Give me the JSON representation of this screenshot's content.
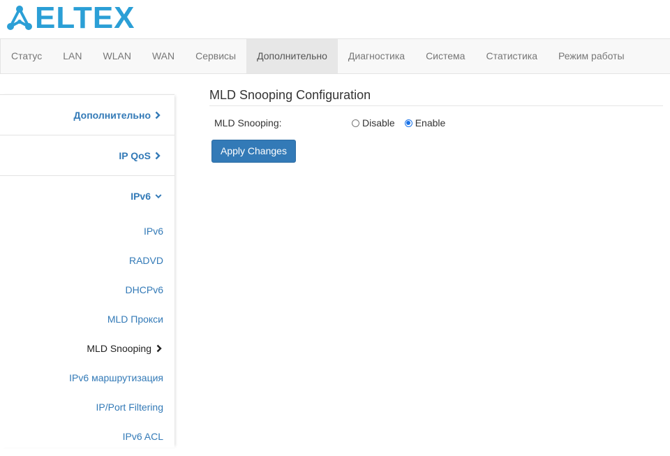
{
  "brand": {
    "logo_text": "ELTEX",
    "accent": "#2b9fd6"
  },
  "nav": {
    "items": [
      {
        "label": "Статус"
      },
      {
        "label": "LAN"
      },
      {
        "label": "WLAN"
      },
      {
        "label": "WAN"
      },
      {
        "label": "Сервисы"
      },
      {
        "label": "Дополнительно",
        "active": true
      },
      {
        "label": "Диагностика"
      },
      {
        "label": "Система"
      },
      {
        "label": "Статистика"
      },
      {
        "label": "Режим работы"
      }
    ]
  },
  "sidebar": {
    "sections": [
      {
        "label": "Дополнительно",
        "icon": "chevron-right-icon"
      },
      {
        "label": "IP QoS",
        "icon": "chevron-right-icon"
      },
      {
        "label": "IPv6",
        "icon": "chevron-down-icon"
      }
    ],
    "subitems": [
      {
        "label": "IPv6"
      },
      {
        "label": "RADVD"
      },
      {
        "label": "DHCPv6"
      },
      {
        "label": "MLD Прокси"
      },
      {
        "label": "MLD Snooping",
        "current": true,
        "icon": "chevron-right-icon"
      },
      {
        "label": "IPv6 маршрутизация"
      },
      {
        "label": "IP/Port Filtering"
      },
      {
        "label": "IPv6 ACL"
      }
    ],
    "link_color": "#337ab7"
  },
  "main": {
    "title": "MLD Snooping Configuration",
    "field_label": "MLD Snooping:",
    "options": [
      {
        "label": "Disable",
        "checked": false
      },
      {
        "label": "Enable",
        "checked": true
      }
    ],
    "apply_label": "Apply Changes",
    "button_color": "#337ab7"
  }
}
